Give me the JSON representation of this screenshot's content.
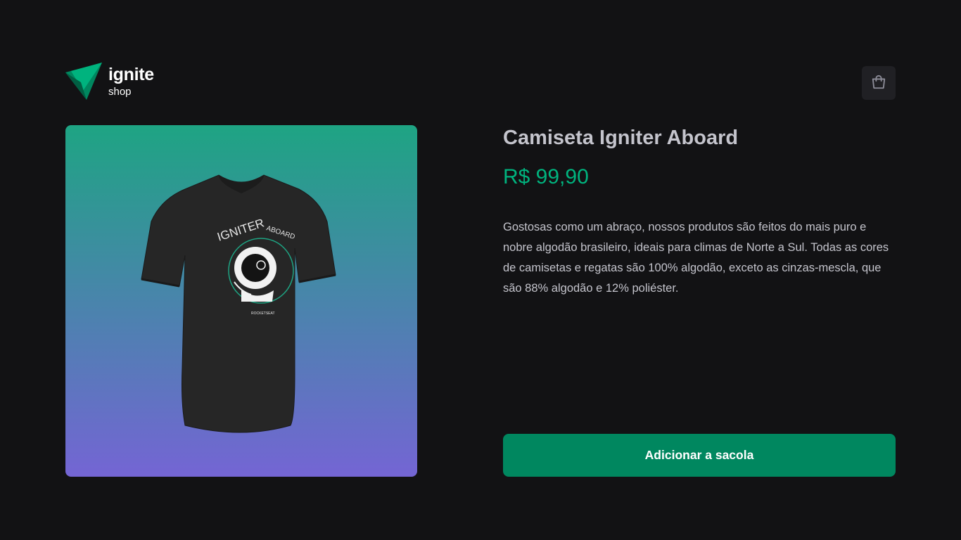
{
  "header": {
    "logo": {
      "title": "ignite",
      "subtitle": "shop",
      "icon": "ignite-logo-icon"
    },
    "cart_button": {
      "icon": "shopping-bag-icon"
    }
  },
  "product": {
    "image_alt": "t-shirt-image",
    "shirt_print": {
      "headline": "IGNITER",
      "subheadline": "ABOARD",
      "tag": "ROCKETSEAT"
    },
    "title": "Camiseta Igniter Aboard",
    "price": "R$ 99,90",
    "description": "Gostosas como um abraço, nossos produtos são feitos do mais puro e nobre algodão brasileiro, ideais para climas de Norte a Sul. Todas as cores de camisetas e regatas são 100% algodão, exceto as cinzas-mescla, que são 88% algodão e 12% poliéster.",
    "add_to_bag_label": "Adicionar a sacola"
  },
  "colors": {
    "background": "#121214",
    "brand": "#00875f",
    "brand_light": "#00b37e",
    "gradient_start": "#1ea483",
    "gradient_end": "#7465d4",
    "text": "#c4c4cc"
  }
}
